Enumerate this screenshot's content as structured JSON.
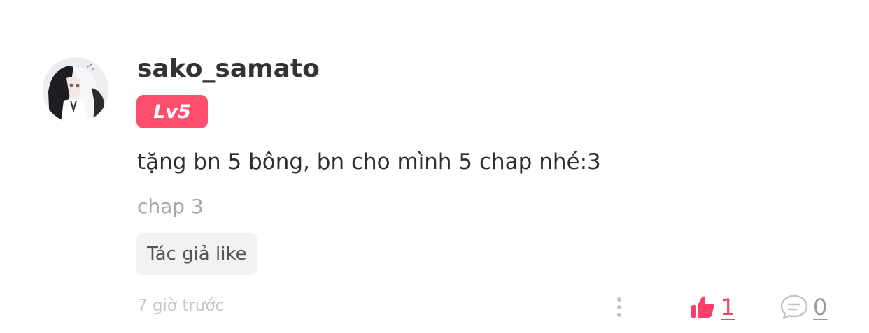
{
  "comment": {
    "username": "sako_samato",
    "level_badge": "Lv5",
    "content": "tặng bn 5 bông, bn cho mình 5 chap nhé:3",
    "chapter": "chap 3",
    "author_liked_label": "Tác giả like",
    "timestamp": "7 giờ trước",
    "like_count": "1",
    "reply_count": "0"
  },
  "colors": {
    "accent": "#ff4f6e",
    "like": "#ff3d6a",
    "muted": "#a8a8a8",
    "username": "#333333",
    "badge_bg": "#f2f2f2"
  },
  "icons": {
    "more": "more-vertical-icon",
    "like": "thumbs-up-icon",
    "reply": "comment-bubble-icon"
  }
}
